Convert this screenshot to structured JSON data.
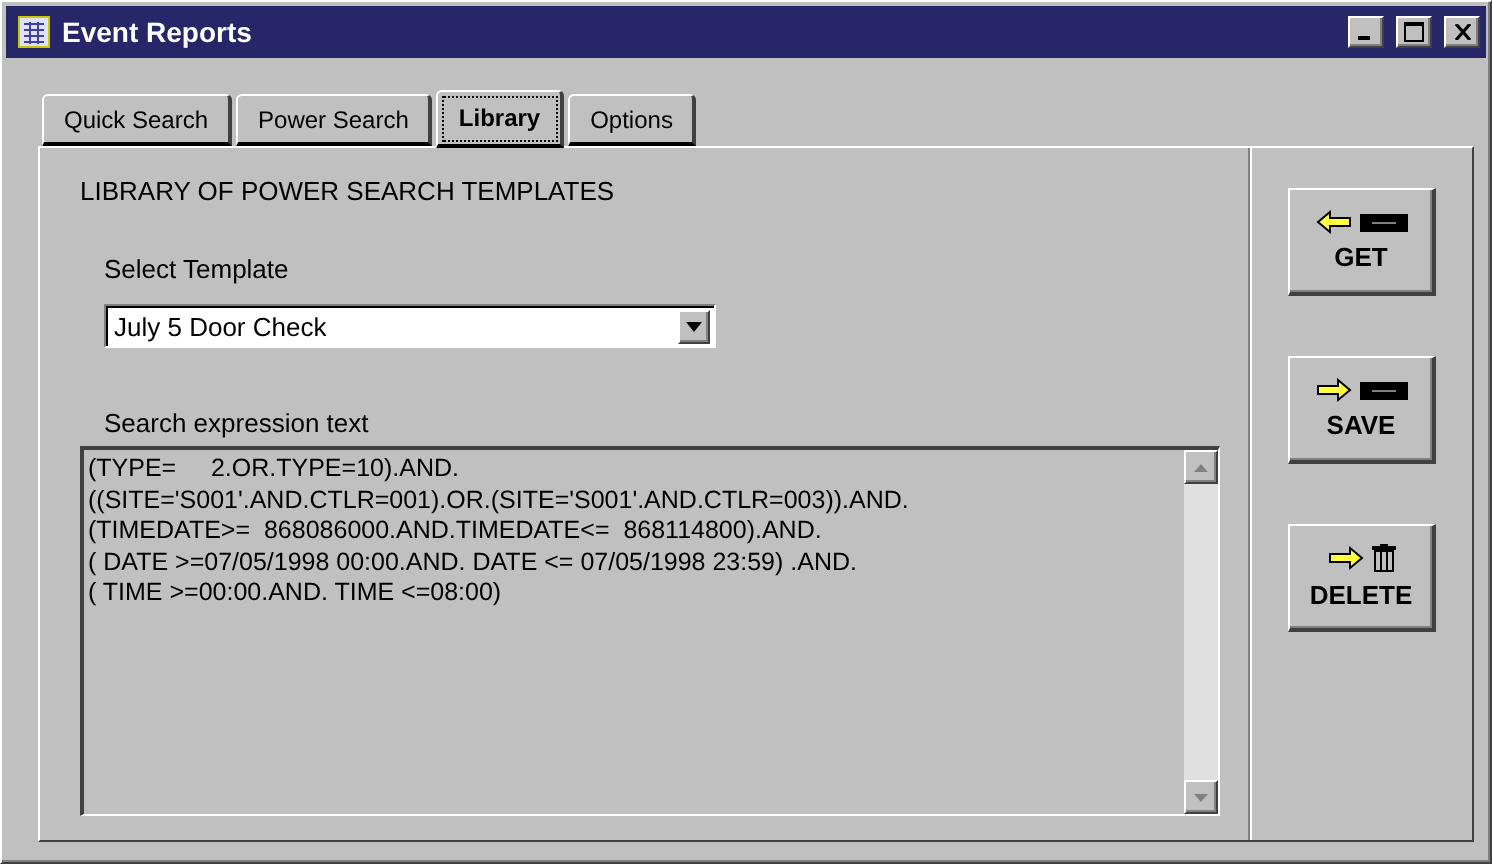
{
  "window": {
    "title": "Event Reports"
  },
  "tabs": [
    {
      "label": "Quick Search",
      "selected": false
    },
    {
      "label": "Power Search",
      "selected": false
    },
    {
      "label": "Library",
      "selected": true
    },
    {
      "label": "Options",
      "selected": false
    }
  ],
  "heading": "LIBRARY OF POWER SEARCH TEMPLATES",
  "template": {
    "label": "Select Template",
    "value": "July 5 Door Check"
  },
  "expression": {
    "label": "Search expression text",
    "lines": [
      "(TYPE=     2.OR.TYPE=10).AND.",
      "((SITE='S001'.AND.CTLR=001).OR.(SITE='S001'.AND.CTLR=003)).AND.",
      "(TIMEDATE>=  868086000.AND.TIMEDATE<=  868114800).AND.",
      "( DATE >=07/05/1998 00:00.AND. DATE <= 07/05/1998 23:59) .AND.",
      "( TIME >=00:00.AND. TIME <=08:00)"
    ]
  },
  "actions": [
    {
      "kind": "get",
      "label": "GET"
    },
    {
      "kind": "save",
      "label": "SAVE"
    },
    {
      "kind": "delete",
      "label": "DELETE"
    }
  ]
}
